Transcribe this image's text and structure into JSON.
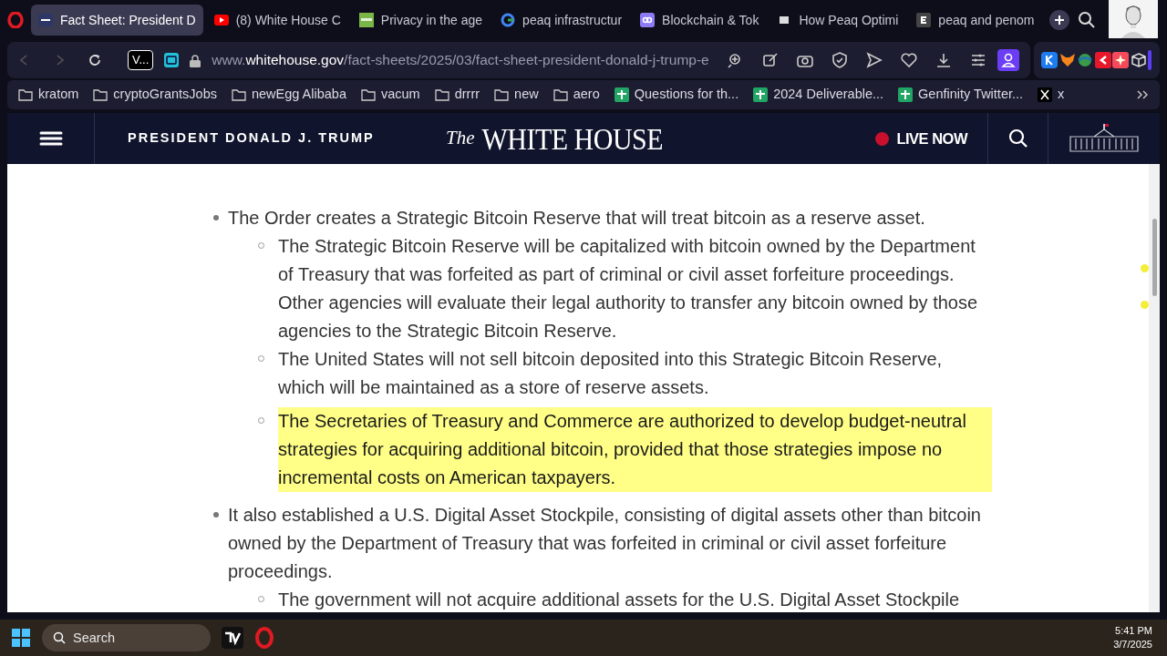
{
  "tabs": [
    {
      "title": "Fact Sheet: President D",
      "kind": "flag",
      "selected": true
    },
    {
      "title": "(8) White House C",
      "kind": "video",
      "selected": false
    },
    {
      "title": "Privacy in the age",
      "kind": "site",
      "selected": false
    },
    {
      "title": "peaq infrastructur",
      "kind": "search",
      "selected": false
    },
    {
      "title": "Blockchain & Tok",
      "kind": "link",
      "selected": false
    },
    {
      "title": "How Peaq Optimi",
      "kind": "page",
      "selected": false
    },
    {
      "title": "peaq and penom",
      "kind": "letter",
      "selected": false
    }
  ],
  "address_bar": {
    "badge": "V...",
    "prefix": "www.",
    "domain": "whitehouse.gov",
    "path": "/fact-sheets/2025/03/fact-sheet-president-donald-j-trump-e"
  },
  "bookmarks": [
    {
      "label": "kratom",
      "kind": "folder"
    },
    {
      "label": "cryptoGrantsJobs",
      "kind": "folder"
    },
    {
      "label": "newEgg Alibaba",
      "kind": "folder"
    },
    {
      "label": "vacum",
      "kind": "folder"
    },
    {
      "label": "drrrr",
      "kind": "folder"
    },
    {
      "label": "new",
      "kind": "folder"
    },
    {
      "label": "aero",
      "kind": "folder"
    },
    {
      "label": "Questions for th...",
      "kind": "sheet"
    },
    {
      "label": "2024 Deliverable...",
      "kind": "sheet"
    },
    {
      "label": "Genfinity Twitter...",
      "kind": "sheet"
    },
    {
      "label": "x",
      "kind": "x"
    }
  ],
  "site_header": {
    "title": "PRESIDENT DONALD J. TRUMP",
    "logo_the": "The",
    "logo_name": "WHITE HOUSE",
    "live": "LIVE NOW"
  },
  "article": [
    {
      "text": "The Order creates a Strategic Bitcoin Reserve that will treat bitcoin as a reserve asset.",
      "highlighted": false,
      "children": [
        {
          "text": "The Strategic Bitcoin Reserve will be capitalized with bitcoin owned by the Department of Treasury that was forfeited as part of criminal or civil asset forfeiture proceedings. Other agencies will evaluate their legal authority to transfer any bitcoin owned by those agencies to the Strategic Bitcoin Reserve.",
          "highlighted": false
        },
        {
          "text": "The United States will not sell bitcoin deposited into this Strategic Bitcoin Reserve, which will be maintained as a store of reserve assets.",
          "highlighted": false
        },
        {
          "text": "The Secretaries of Treasury and Commerce are authorized to develop budget-neutral strategies for acquiring additional bitcoin, provided that those strategies impose no incremental costs on American taxpayers.",
          "highlighted": true
        }
      ]
    },
    {
      "text": "It also established a U.S. Digital Asset Stockpile, consisting of digital assets other than bitcoin owned by the Department of Treasury that was forfeited in criminal or civil asset forfeiture proceedings.",
      "highlighted": false,
      "children": [
        {
          "text": "The government will not acquire additional assets for the U.S. Digital Asset Stockpile",
          "highlighted": false
        }
      ]
    }
  ],
  "taskbar": {
    "search_placeholder": "Search",
    "time": "5:41 PM",
    "date": "3/7/2025"
  }
}
